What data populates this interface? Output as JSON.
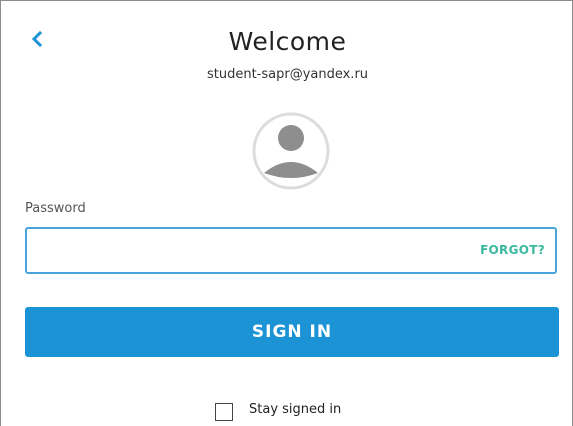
{
  "header": {
    "title": "Welcome",
    "email": "student-sapr@yandex.ru"
  },
  "icons": {
    "back": "chevron-left-icon",
    "avatar": "user-avatar-icon"
  },
  "password": {
    "label": "Password",
    "value": "",
    "placeholder": "",
    "forgot_label": "FORGOT?"
  },
  "actions": {
    "signin_label": "SIGN IN"
  },
  "options": {
    "stay_signed_in_label": "Stay signed in",
    "stay_signed_in_checked": false
  },
  "colors": {
    "accent": "#1b93d4",
    "field_border": "#4aa3dc",
    "forgot": "#3ab8a0",
    "back_arrow": "#1b93d4"
  }
}
